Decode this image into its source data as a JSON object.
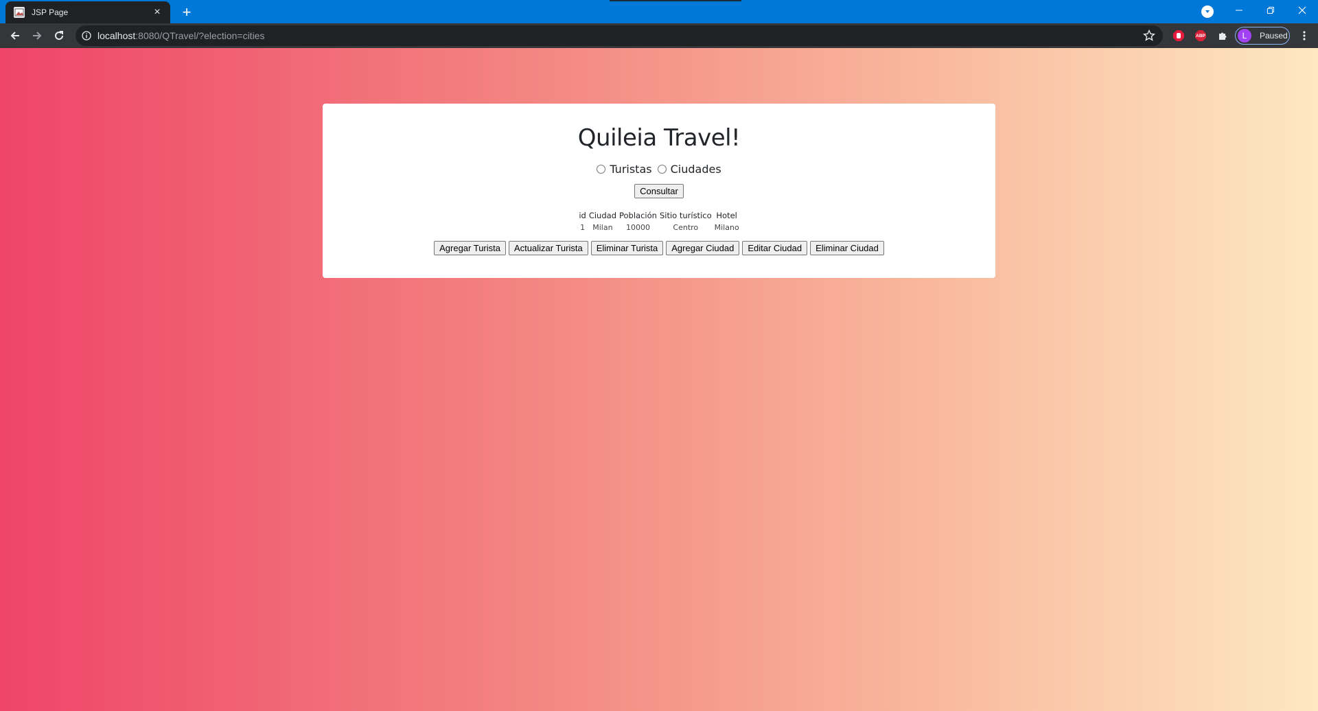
{
  "browser": {
    "tab_title": "JSP Page",
    "tab_close": "×",
    "new_tab": "+",
    "url_host": "localhost",
    "url_path": ":8080/QTravel/?election=cities",
    "profile_initial": "L",
    "profile_status": "Paused",
    "extensions": [
      "adblock-extension-icon",
      "abp-extension-icon",
      "puzzle-extensions-icon"
    ],
    "abp_label": "ABP"
  },
  "page": {
    "title": "Quileia Travel!",
    "radio_options": [
      {
        "label": "Turistas",
        "checked": false
      },
      {
        "label": "Ciudades",
        "checked": false
      }
    ],
    "consult_button": "Consultar",
    "table": {
      "headers": [
        "id",
        "Ciudad",
        "Población",
        "Sitio turístico",
        "Hotel"
      ],
      "rows": [
        [
          "1",
          "Milan",
          "10000",
          "Centro",
          "Milano"
        ]
      ]
    },
    "actions": [
      "Agregar Turista",
      "Actualizar Turista",
      "Eliminar Turista",
      "Agregar Ciudad",
      "Editar Ciudad",
      "Eliminar Ciudad"
    ]
  },
  "colors": {
    "titlebar": "#0078d7",
    "toolbar": "#35363a",
    "gradient_start": "#ef4468",
    "gradient_end": "#fde8c2"
  }
}
